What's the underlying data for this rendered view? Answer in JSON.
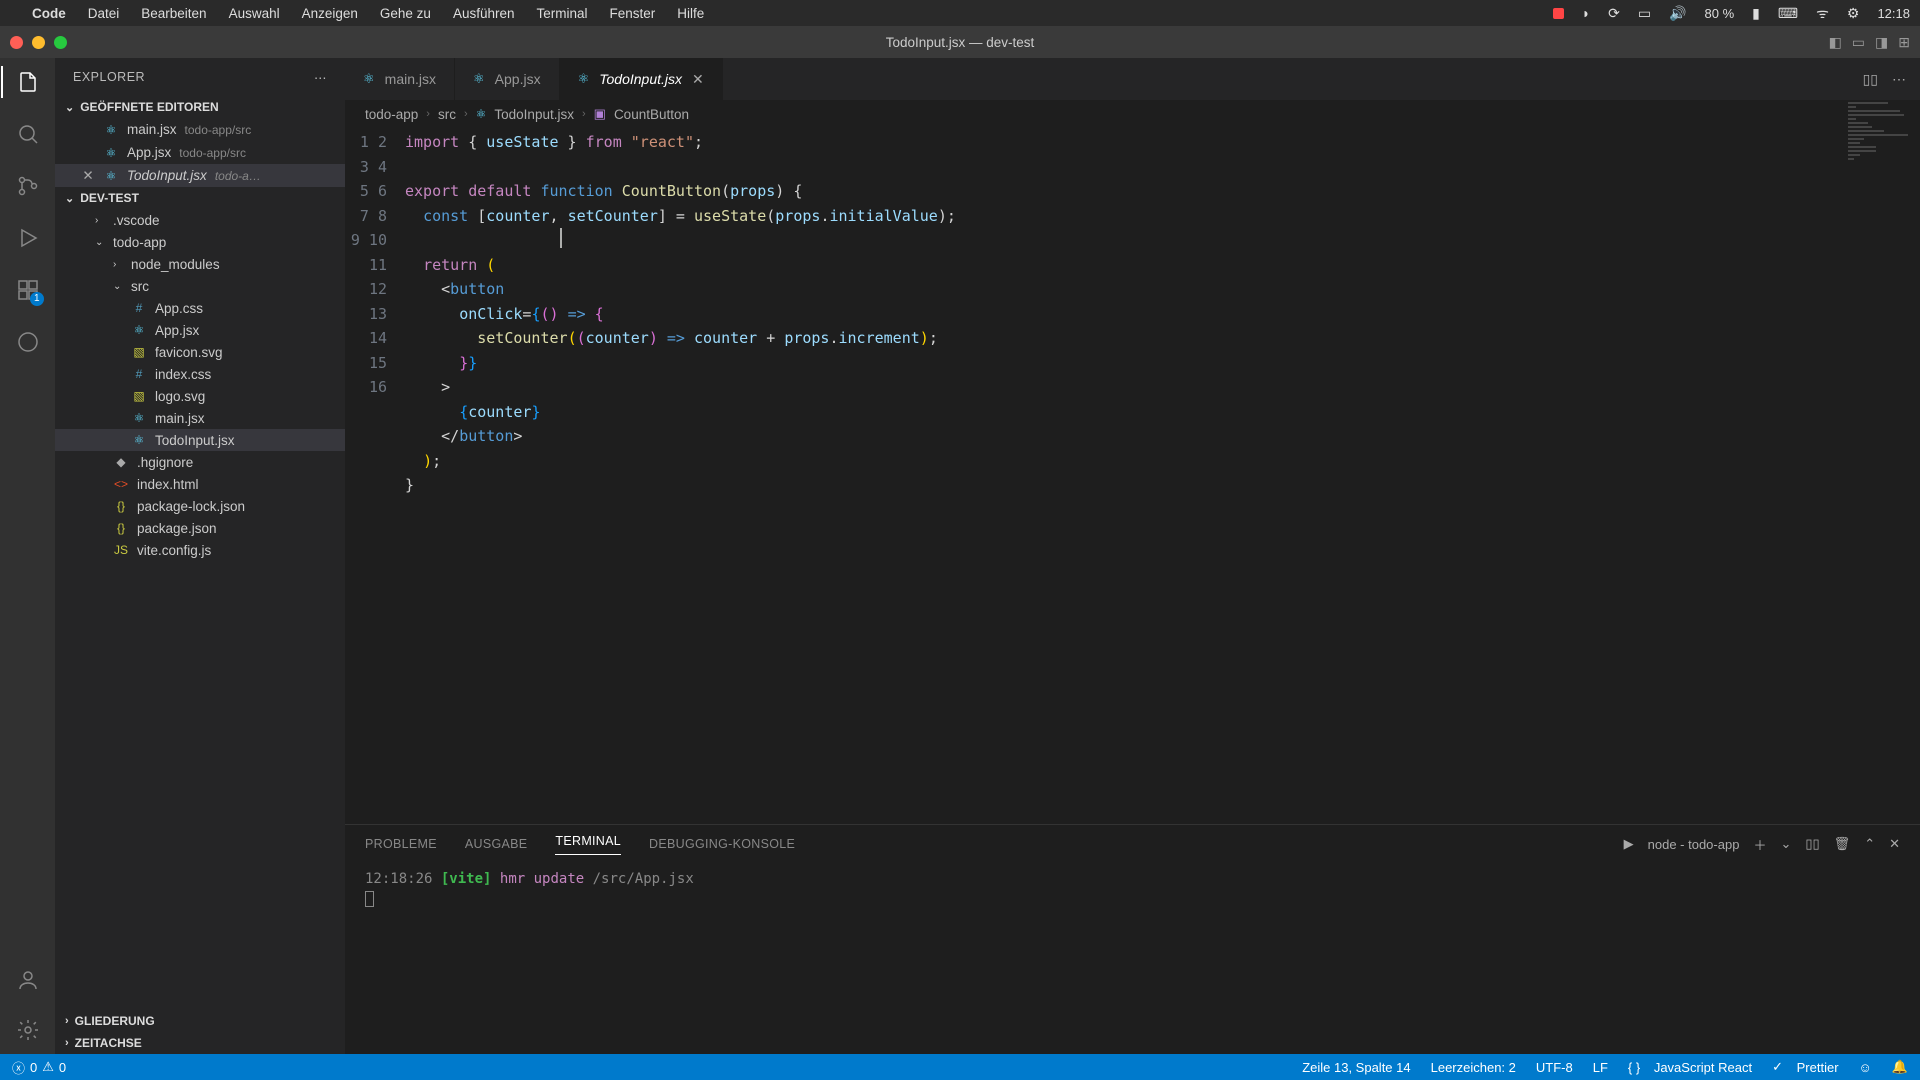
{
  "mac_menu": {
    "app": "Code",
    "items": [
      "Datei",
      "Bearbeiten",
      "Auswahl",
      "Anzeigen",
      "Gehe zu",
      "Ausführen",
      "Terminal",
      "Fenster",
      "Hilfe"
    ],
    "battery": "80 %",
    "battery_icon": "◧",
    "time": "12:18"
  },
  "window": {
    "title": "TodoInput.jsx — dev-test"
  },
  "explorer": {
    "title": "EXPLORER",
    "sections": {
      "open_editors": "GEÖFFNETE EDITOREN",
      "project": "DEV-TEST",
      "outline": "GLIEDERUNG",
      "timeline": "ZEITACHSE"
    },
    "open_editors": [
      {
        "name": "main.jsx",
        "path": "todo-app/src",
        "active": false
      },
      {
        "name": "App.jsx",
        "path": "todo-app/src",
        "active": false
      },
      {
        "name": "TodoInput.jsx",
        "path": "todo-a…",
        "active": true
      }
    ],
    "tree": {
      "vscode": ".vscode",
      "todo_app": "todo-app",
      "node_modules": "node_modules",
      "src": "src",
      "files_src": [
        "App.css",
        "App.jsx",
        "favicon.svg",
        "index.css",
        "logo.svg",
        "main.jsx",
        "TodoInput.jsx"
      ],
      "files_root": [
        ".hgignore",
        "index.html",
        "package-lock.json",
        "package.json",
        "vite.config.js"
      ]
    },
    "activity_badge": "1"
  },
  "tabs": [
    {
      "name": "main.jsx",
      "active": false
    },
    {
      "name": "App.jsx",
      "active": false
    },
    {
      "name": "TodoInput.jsx",
      "active": true
    }
  ],
  "breadcrumb": [
    "todo-app",
    "src",
    "TodoInput.jsx",
    "CountButton"
  ],
  "code": {
    "lines": 16,
    "line1": {
      "import": "import",
      "useState": "useState",
      "from": "from",
      "react": "\"react\""
    },
    "line3": {
      "export": "export",
      "default": "default",
      "function": "function",
      "name": "CountButton",
      "props": "props"
    },
    "line4": {
      "const": "const",
      "counter": "counter",
      "setCounter": "setCounter",
      "useState": "useState",
      "props": "props",
      "initialValue": "initialValue"
    },
    "line6": {
      "return": "return"
    },
    "line7": {
      "button": "button"
    },
    "line8": {
      "onClick": "onClick"
    },
    "line9": {
      "setCounter": "setCounter",
      "counter": "counter",
      "props": "props",
      "increment": "increment"
    },
    "line12": {
      "counter": "counter"
    },
    "line13": {
      "button": "button"
    }
  },
  "panel": {
    "tabs": [
      "PROBLEME",
      "AUSGABE",
      "TERMINAL",
      "DEBUGGING-KONSOLE"
    ],
    "active": "TERMINAL",
    "terminal_label": "node - todo-app",
    "terminal": {
      "time": "12:18:26",
      "vite": "[vite]",
      "msg": "hmr update",
      "path": "/src/App.jsx"
    }
  },
  "statusbar": {
    "errors": "0",
    "warnings": "0",
    "cursor": "Zeile 13, Spalte 14",
    "spaces": "Leerzeichen: 2",
    "encoding": "UTF-8",
    "eol": "LF",
    "lang": "JavaScript React",
    "prettier": "Prettier"
  }
}
